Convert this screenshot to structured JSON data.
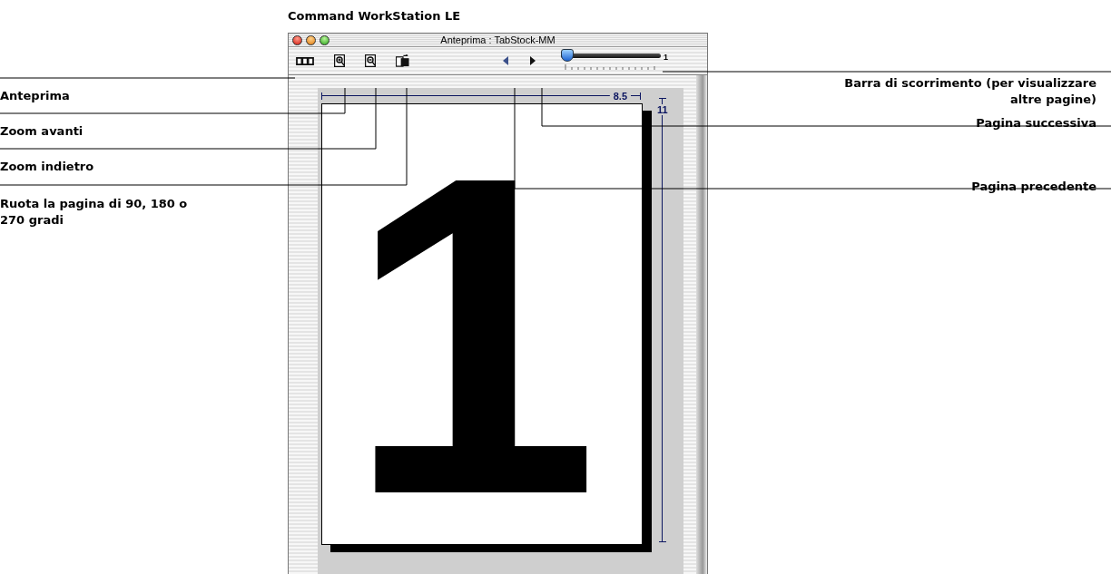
{
  "heading": "Command WorkStation LE",
  "window": {
    "title": "Anteprima : TabStock-MM"
  },
  "toolbar": {
    "buttons": [
      {
        "kind": "thumbnails"
      },
      {
        "kind": "zoom-in"
      },
      {
        "kind": "zoom-out"
      },
      {
        "kind": "rotate"
      }
    ],
    "nav": [
      {
        "kind": "previous"
      },
      {
        "kind": "next"
      }
    ],
    "slider": {
      "level": 0,
      "reading": "1"
    }
  },
  "preview": {
    "width_label": "8.5",
    "height_label": "11",
    "page_number": "1"
  },
  "callouts_left": [
    {
      "text": "Anteprima"
    },
    {
      "text": "Zoom avanti"
    },
    {
      "text": "Zoom indietro"
    },
    {
      "text": "Ruota la pagina di 90, 180 o 270 gradi"
    }
  ],
  "callouts_right": [
    {
      "text": "Barra di scorrimento (per visualizzare altre pagine)"
    },
    {
      "text": "Pagina successiva"
    },
    {
      "text": "Pagina precedente"
    }
  ]
}
